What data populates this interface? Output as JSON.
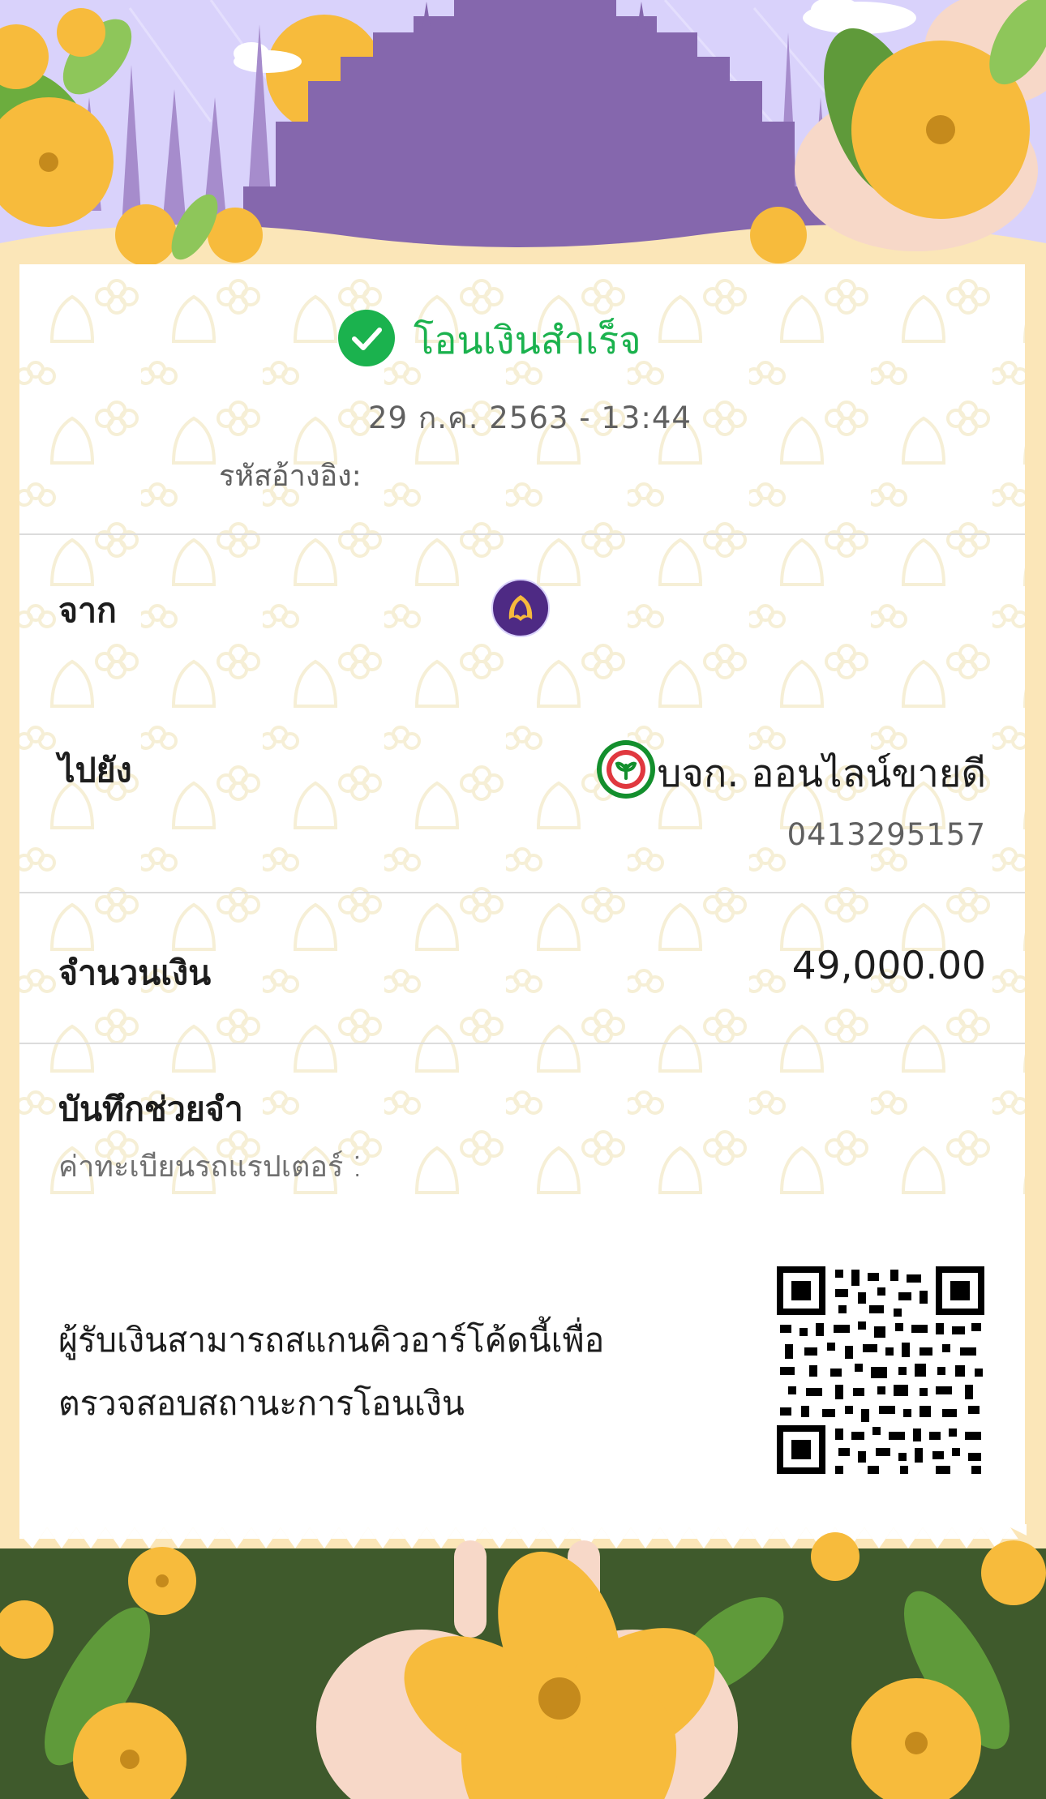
{
  "status": {
    "text": "โอนเงินสำเร็จ",
    "icon": "check-circle-icon",
    "color": "#1bb24e"
  },
  "datetime": "29 ก.ค. 2563 - 13:44",
  "reference": {
    "label": "รหัสอ้างอิง:",
    "value": ""
  },
  "from": {
    "label": "จาก",
    "bank_icon": "scb-bank-logo-icon",
    "bank_color": "#4e2a84",
    "name": "",
    "account": ""
  },
  "to": {
    "label": "ไปยัง",
    "bank_icon": "kbank-logo-icon",
    "bank_color": "#138f2d",
    "name": "บจก. ออนไลน์ขายดี",
    "account": "0413295157"
  },
  "amount": {
    "label": "จำนวนเงิน",
    "value": "49,000.00"
  },
  "memo": {
    "label": "บันทึกช่วยจำ",
    "value": "ค่าทะเบียนรถแรปเตอร์ 1"
  },
  "qr": {
    "caption": "ผู้รับเงินสามารถสแกนคิวอาร์โค้ดนี้เพื่อ ตรวจสอบสถานะการโอนเงิน",
    "icon": "qr-code-icon"
  },
  "theme": {
    "background": "#fbe6b8",
    "banner_sky": "#d9d2fb",
    "temple": "#8567ad",
    "bottom_green": "#3f5a2c",
    "flower": "#f7bb3c"
  }
}
